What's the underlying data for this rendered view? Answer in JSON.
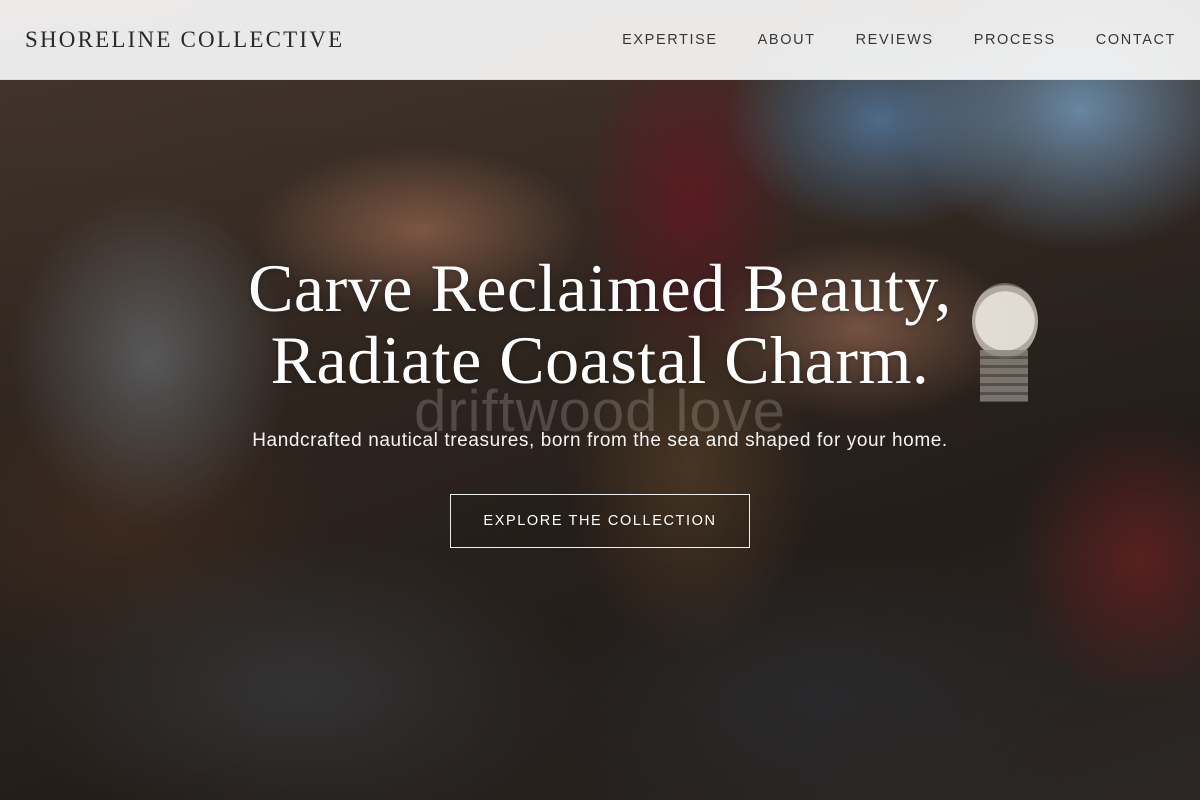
{
  "header": {
    "brand": "SHORELINE COLLECTIVE",
    "nav": [
      {
        "label": "EXPERTISE"
      },
      {
        "label": "ABOUT"
      },
      {
        "label": "REVIEWS"
      },
      {
        "label": "PROCESS"
      },
      {
        "label": "CONTACT"
      }
    ]
  },
  "hero": {
    "headline_line1": "Carve Reclaimed Beauty,",
    "headline_line2": "Radiate Coastal Charm.",
    "watermark": "driftwood love",
    "tagline": "Handcrafted nautical treasures, born from the sea and shaped for your home.",
    "cta_label": "EXPLORE THE COLLECTION"
  },
  "colors": {
    "header_bg": "#f8f8f7",
    "brand_text": "#2c2a27",
    "hero_text": "#ffffff"
  }
}
